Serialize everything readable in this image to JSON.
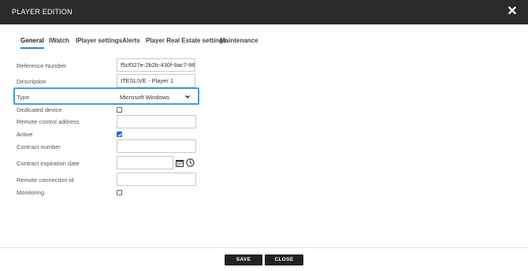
{
  "dialog": {
    "title": "PLAYER EDITION",
    "close_icon": "close-icon"
  },
  "tabs": [
    {
      "label": "General",
      "active": true
    },
    {
      "label": "IWatch"
    },
    {
      "label": "IPlayer settings"
    },
    {
      "label": "Alerts"
    },
    {
      "label": "Player Real Estate settings"
    },
    {
      "label": "Maintenance"
    }
  ],
  "form": {
    "reference_number": {
      "label": "Reference Number",
      "value": "f5cf027e-2b2b-430f-9ac7-96"
    },
    "description": {
      "label": "Description",
      "value": "ITESLIVE - Player 1"
    },
    "type": {
      "label": "Type",
      "value": "Microsoft Windows"
    },
    "dedicated_device": {
      "label": "Dedicated device",
      "checked": false
    },
    "remote_control_address": {
      "label": "Remote control address",
      "value": ""
    },
    "active": {
      "label": "Active",
      "checked": true
    },
    "contract_number": {
      "label": "Contract number",
      "value": ""
    },
    "contract_expiration_date": {
      "label": "Contract expiration date",
      "value": ""
    },
    "remote_connection_id": {
      "label": "Remote connection id",
      "value": ""
    },
    "monitoring": {
      "label": "Monitoring",
      "checked": false
    }
  },
  "footer": {
    "save_label": "SAVE",
    "close_label": "CLOSE"
  },
  "colors": {
    "titlebar": "#2b2b2b",
    "accent": "#2b88c8",
    "highlight": "#3ea2d6",
    "button": "#222222"
  }
}
